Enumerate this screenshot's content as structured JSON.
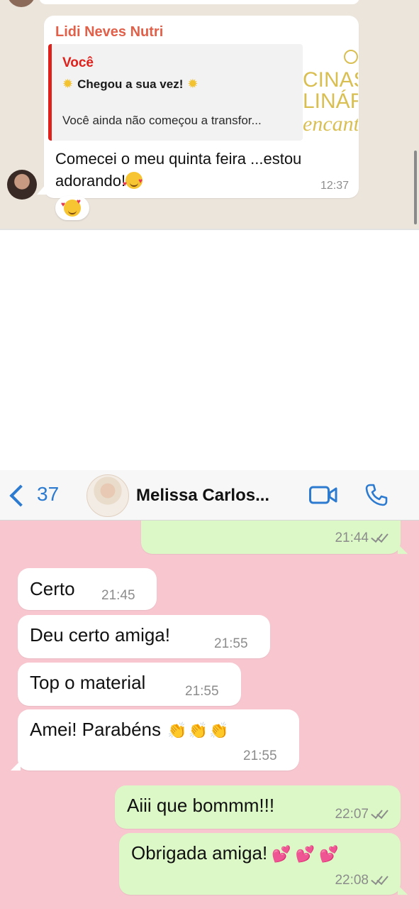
{
  "top_chat": {
    "sender_name": "Lidi Neves Nutri",
    "quoted": {
      "author": "Você",
      "line1": "Chegou a sua vez!",
      "line2": "Você ainda não começou a transfor...",
      "thumb_lines": [
        "CINAS",
        "LINÁR",
        "encanta"
      ]
    },
    "message_line1": "Comecei o meu quinta feira ...estou",
    "message_line2": "adorando!",
    "time": "12:37",
    "reaction_icon": "smiling-face-with-hearts-icon"
  },
  "header": {
    "back_count": "37",
    "contact_name": "Melissa Carlos...",
    "accent_color": "#2c7bd0"
  },
  "bottom_chat": {
    "background_color": "#f7c6cf",
    "messages": [
      {
        "direction": "out",
        "text": "",
        "time": "21:44",
        "read": true
      },
      {
        "direction": "in",
        "text": "Certo",
        "time": "21:45"
      },
      {
        "direction": "in",
        "text": "Deu certo amiga!",
        "time": "21:55"
      },
      {
        "direction": "in",
        "text": "Top o material",
        "time": "21:55"
      },
      {
        "direction": "in",
        "text": "Amei! Parabéns",
        "time": "21:55",
        "emoji": "clapping-hands-icon"
      },
      {
        "direction": "out",
        "text": "Aiii que bommm!!!",
        "time": "22:07",
        "read": true
      },
      {
        "direction": "out",
        "text": "Obrigada amiga!",
        "time": "22:08",
        "read": true,
        "emoji": "two-hearts-icon"
      }
    ]
  }
}
